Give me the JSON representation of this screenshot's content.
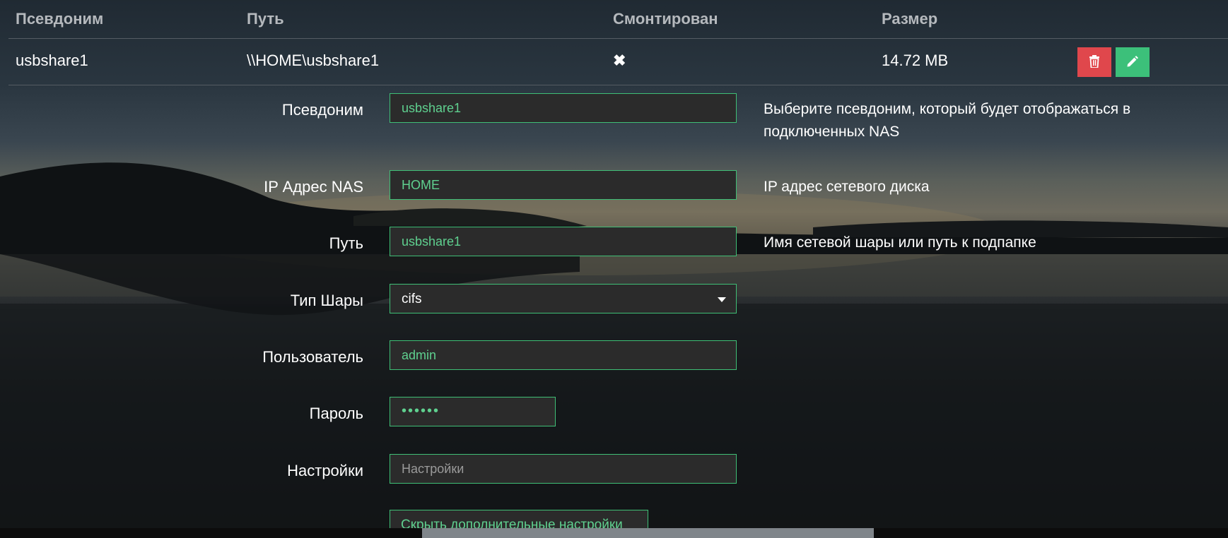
{
  "table": {
    "headers": {
      "alias": "Псевдоним",
      "path": "Путь",
      "mounted": "Смонтирован",
      "size": "Размер"
    },
    "row": {
      "alias": "usbshare1",
      "path": "\\\\HOME\\usbshare1",
      "mounted_symbol": "✖",
      "size": "14.72 MB"
    }
  },
  "form": {
    "alias": {
      "label": "Псевдоним",
      "value": "usbshare1",
      "help": "Выберите псевдоним, который будет отображаться в подключенных NAS"
    },
    "ip": {
      "label": "IP Адрес NAS",
      "value": "HOME",
      "help": "IP адрес сетевого диска"
    },
    "path": {
      "label": "Путь",
      "value": "usbshare1",
      "help": "Имя сетевой шары или путь к подпапке"
    },
    "share_type": {
      "label": "Тип Шары",
      "value": "cifs"
    },
    "user": {
      "label": "Пользователь",
      "value": "admin"
    },
    "password": {
      "label": "Пароль",
      "value": "••••••"
    },
    "options": {
      "label": "Настройки",
      "placeholder": "Настройки"
    },
    "toggle_label": "Скрыть дополнительные настройки"
  },
  "colors": {
    "accent": "#3cc07a",
    "danger": "#e0474c",
    "unmounted": "#e05252"
  },
  "icons": {
    "delete": "trash-icon",
    "edit": "pencil-icon",
    "status": "cross-icon",
    "dropdown": "caret-down-icon"
  }
}
